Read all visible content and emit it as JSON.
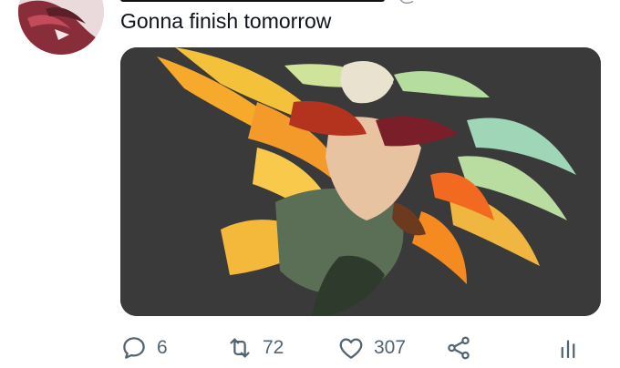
{
  "tweet": {
    "text": "Gonna finish tomorrow",
    "handle_fragment": "@"
  },
  "actions": {
    "reply_count": "6",
    "retweet_count": "72",
    "like_count": "307"
  },
  "icons": {
    "reply": "reply-icon",
    "retweet": "retweet-icon",
    "like": "heart-icon",
    "share": "share-icon",
    "stats": "stats-icon"
  },
  "colors": {
    "icon_gray": "#536471",
    "text": "#0f1419",
    "media_bg": "#3a3a3a"
  }
}
